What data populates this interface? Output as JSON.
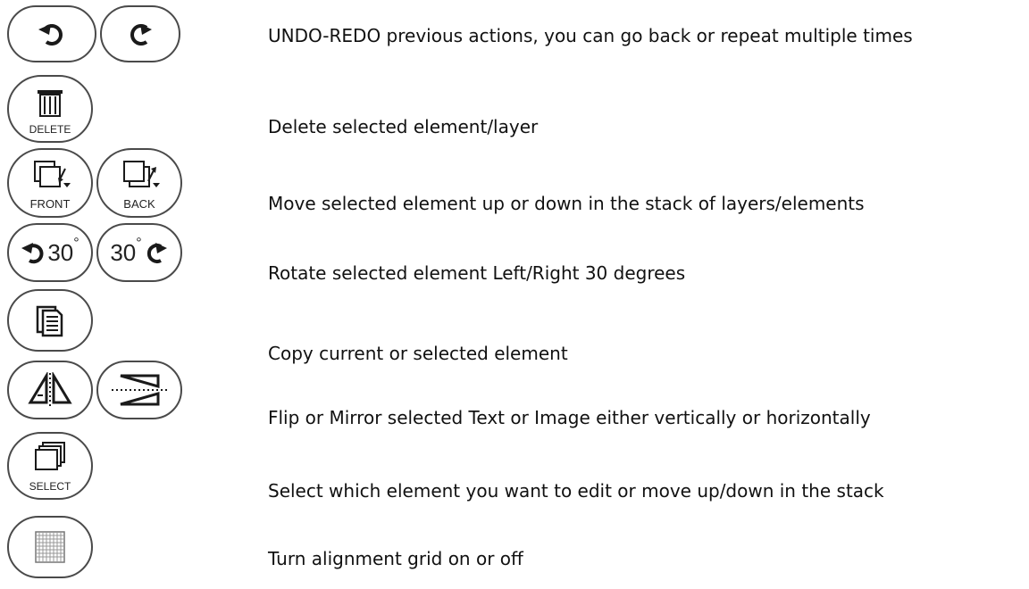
{
  "rows": [
    {
      "desc": "UNDO-REDO previous actions, you can go back or repeat multiple times"
    },
    {
      "desc": "Delete selected element/layer",
      "btn_label": "DELETE"
    },
    {
      "desc": "Move selected element up  or down in the stack of layers/elements",
      "front_label": "FRONT",
      "back_label": "BACK"
    },
    {
      "desc": "Rotate selected element Left/Right 30 degrees",
      "rotate_value": "30",
      "degree_mark": "°"
    },
    {
      "desc": "Copy current or selected element"
    },
    {
      "desc": "Flip or Mirror selected Text or Image either vertically or horizontally"
    },
    {
      "desc": "Select which element you want to edit or move up/down in the stack",
      "btn_label": "SELECT"
    },
    {
      "desc": "Turn alignment grid on or off"
    }
  ]
}
